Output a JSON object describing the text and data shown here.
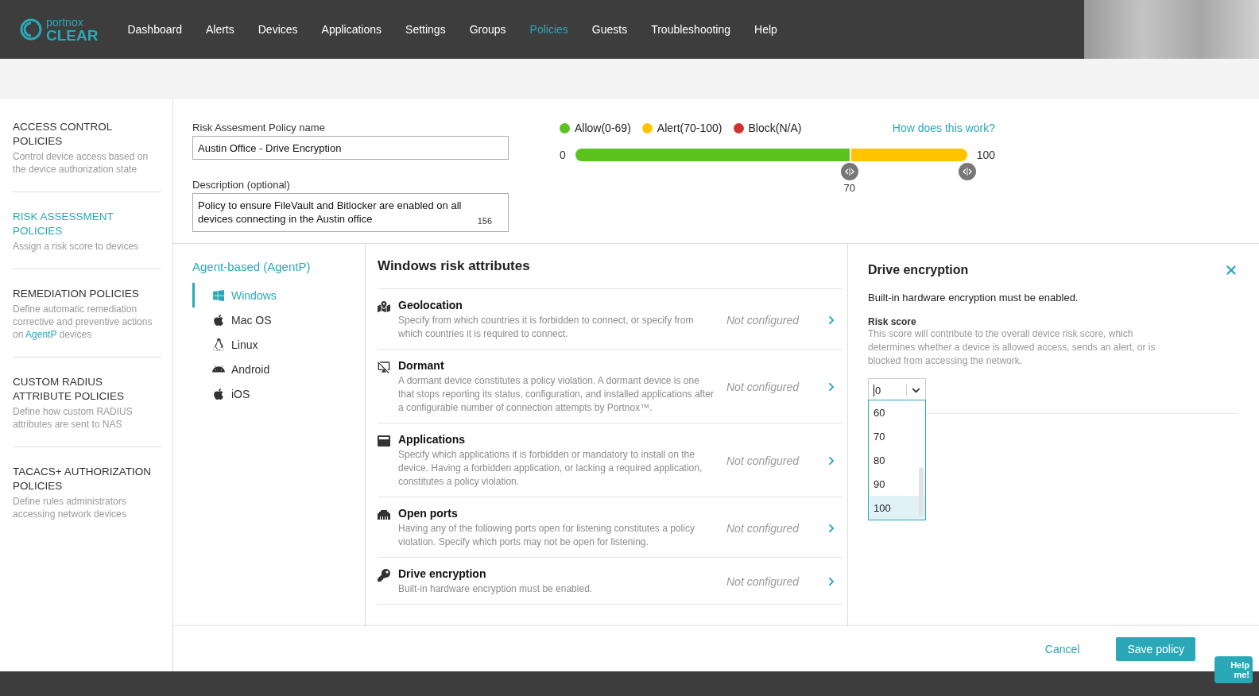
{
  "header": {
    "logo": {
      "top": "portnox",
      "bottom": "CLEAR"
    },
    "nav": [
      {
        "label": "Dashboard",
        "selected": false
      },
      {
        "label": "Alerts",
        "selected": false
      },
      {
        "label": "Devices",
        "selected": false
      },
      {
        "label": "Applications",
        "selected": false
      },
      {
        "label": "Settings",
        "selected": false
      },
      {
        "label": "Groups",
        "selected": false
      },
      {
        "label": "Policies",
        "selected": true
      },
      {
        "label": "Guests",
        "selected": false
      },
      {
        "label": "Troubleshooting",
        "selected": false
      },
      {
        "label": "Help",
        "selected": false
      }
    ]
  },
  "sidebar": {
    "items": [
      {
        "title": "ACCESS CONTROL POLICIES",
        "selected": false,
        "description": [
          {
            "text": "Control device access based on the device authorization state"
          }
        ]
      },
      {
        "title": "RISK ASSESSMENT POLICIES",
        "selected": true,
        "description": [
          {
            "text": "Assign a risk score to devices"
          }
        ]
      },
      {
        "title": "REMEDIATION POLICIES",
        "selected": false,
        "description": [
          {
            "text": "Define automatic remediation corrective and preventive actions on "
          },
          {
            "link": "AgentP"
          },
          {
            "text": " devices"
          }
        ]
      },
      {
        "title": "CUSTOM RADIUS ATTRIBUTE POLICIES",
        "selected": false,
        "description": [
          {
            "text": "Define how custom RADIUS attributes are sent to NAS"
          }
        ]
      },
      {
        "title": "TACACS+ AUTHORIZATION POLICIES",
        "selected": false,
        "description": [
          {
            "text": "Define rules administrators accessing network devices"
          }
        ]
      }
    ]
  },
  "form": {
    "name_label": "Risk Assesment Policy name",
    "name_value": "Austin Office - Drive Encryption",
    "description_label": "Description (optional)",
    "description_value": "Policy to ensure FileVault and Bitlocker are enabled on all devices connecting in the Austin office",
    "description_count": "156"
  },
  "score_range": {
    "legend": [
      {
        "label": "Allow(0-69)",
        "color": "#5ac31e"
      },
      {
        "label": "Alert(70-100)",
        "color": "#ffc400"
      },
      {
        "label": "Block(N/A)",
        "color": "#d13232"
      }
    ],
    "help_link": "How does this work?",
    "min_label": "0",
    "max_label": "100",
    "handles": [
      {
        "level": 0.7,
        "label": "70"
      },
      {
        "level": 1.0
      }
    ]
  },
  "platforms": {
    "group": "Agent-based (AgentP)",
    "items": [
      {
        "label": "Windows",
        "selected": true
      },
      {
        "label": "Mac OS",
        "selected": false
      },
      {
        "label": "Linux",
        "selected": false
      },
      {
        "label": "Android",
        "selected": false
      },
      {
        "label": "iOS",
        "selected": false
      }
    ]
  },
  "attributes": {
    "title": "Windows risk attributes",
    "items": [
      {
        "name": "Geolocation",
        "description": "Specify from which countries it is forbidden to connect, or specify from which countries it is required to connect.",
        "status": "Not configured"
      },
      {
        "name": "Dormant",
        "description": "A dormant device constitutes a policy violation. A dormant device is one that stops reporting its status, configuration, and installed applications after a configurable number of connection attempts by Portnox™.",
        "status": "Not configured"
      },
      {
        "name": "Applications",
        "description": "Specify which applications it is forbidden or mandatory to install on the device. Having a forbidden application, or lacking a required application, constitutes a policy violation.",
        "status": "Not configured"
      },
      {
        "name": "Open ports",
        "description": "Having any of the following ports open for listening constitutes a policy violation. Specify which ports may not be open for listening.",
        "status": "Not configured"
      },
      {
        "name": "Drive encryption",
        "description": "Built-in hardware encryption must be enabled.",
        "status": "Not configured"
      }
    ]
  },
  "detail": {
    "title": "Drive encryption",
    "description": "Built-in hardware encryption must be enabled.",
    "score_label": "Risk score",
    "score_hint": "This score will contribute to the overall device risk score, which determines whether a device is allowed access, sends an alert, or is blocked from accessing the network.",
    "score_value": "0",
    "options": [
      {
        "label": "60",
        "selected": false
      },
      {
        "label": "70",
        "selected": false
      },
      {
        "label": "80",
        "selected": false
      },
      {
        "label": "90",
        "selected": false
      },
      {
        "label": "100",
        "selected": true
      }
    ]
  },
  "actions": {
    "cancel": "Cancel",
    "save": "Save policy"
  },
  "help_button": "Help me!"
}
